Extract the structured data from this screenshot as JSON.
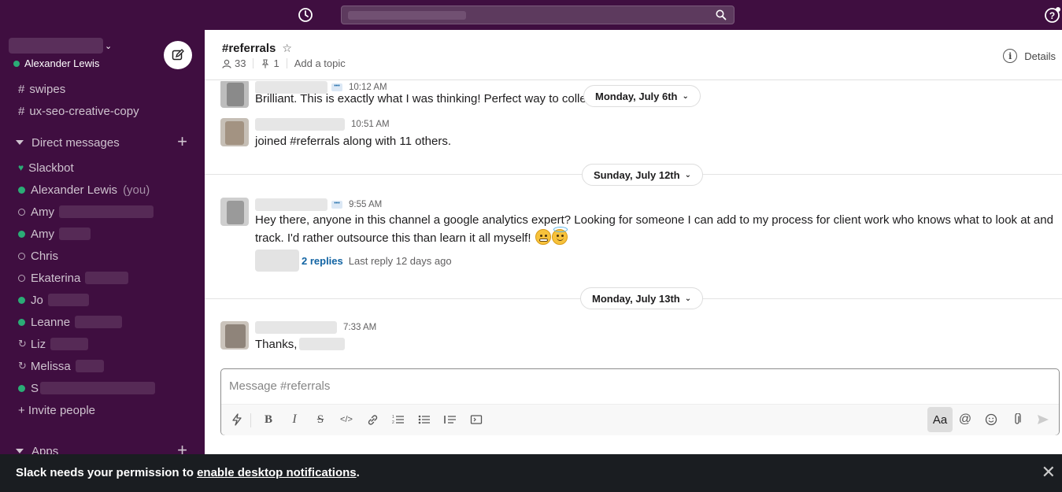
{
  "topbar": {
    "search_icon": "search-icon",
    "history_icon": "clock-icon",
    "help_icon": "help-icon"
  },
  "sidebar": {
    "current_user": "Alexander Lewis",
    "channels": [
      "swipes",
      "ux-seo-creative-copy"
    ],
    "direct_messages_label": "Direct messages",
    "dms": [
      {
        "name": "Slackbot",
        "status": "heart"
      },
      {
        "name": "Alexander Lewis",
        "suffix": "(you)",
        "status": "online"
      },
      {
        "name": "Amy",
        "status": "away"
      },
      {
        "name": "Amy",
        "status": "online"
      },
      {
        "name": "Chris",
        "status": "away"
      },
      {
        "name": "Ekaterina",
        "status": "away"
      },
      {
        "name": "Jo",
        "status": "online"
      },
      {
        "name": "Leanne",
        "status": "online"
      },
      {
        "name": "Liz",
        "status": "refresh"
      },
      {
        "name": "Melissa",
        "status": "refresh"
      },
      {
        "name": "S",
        "status": "online"
      }
    ],
    "invite_label": "+ Invite people",
    "apps_label": "Apps"
  },
  "header": {
    "channel": "#referrals",
    "members": "33",
    "pins": "1",
    "topic": "Add a topic",
    "details": "Details"
  },
  "messages": [
    {
      "time": "10:12 AM",
      "text": "Brilliant. This is exactly what I was thinking! Perfect way to collec"
    },
    {
      "time": "10:51 AM",
      "text": "joined #referrals along with 11 others."
    },
    {
      "time": "9:55 AM",
      "text": "Hey there, anyone in this channel a google analytics expert? Looking for someone I can add to my process for client work who knows what to look at and",
      "text2": "track. I'd rather outsource this than learn it all myself!",
      "replies": "2 replies",
      "last_reply": "Last reply 12 days ago"
    },
    {
      "time": "7:33 AM",
      "text": "Thanks,"
    }
  ],
  "day_dividers": [
    "Monday, July 6th",
    "Sunday, July 12th",
    "Monday, July 13th"
  ],
  "composer": {
    "placeholder": "Message #referrals",
    "aa_label": "Aa"
  },
  "banner": {
    "text": "Slack needs your permission to ",
    "link": "enable desktop notifications",
    "end": "."
  },
  "colors": {
    "sidebar": "#3f0e40",
    "online": "#2bac76",
    "link": "#1264a3",
    "banner": "#1a1d21"
  }
}
